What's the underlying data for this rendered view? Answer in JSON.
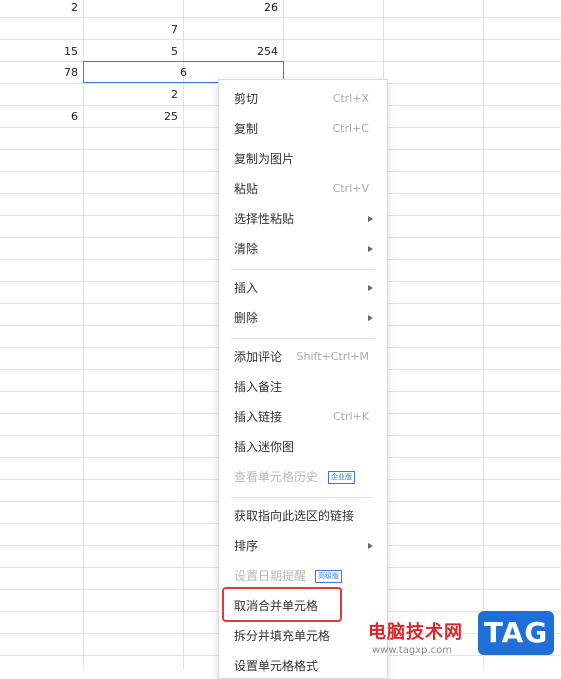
{
  "sheet": {
    "rows": [
      {
        "a": "2",
        "b": "",
        "c": "26"
      },
      {
        "a": "",
        "b": "7",
        "c": ""
      },
      {
        "a": "15",
        "b": "5",
        "c": "254"
      },
      {
        "a": "78",
        "merged": "6"
      },
      {
        "a": "",
        "b": "2",
        "c": ""
      },
      {
        "a": "6",
        "b": "25",
        "c": ""
      }
    ]
  },
  "menu": {
    "cut": {
      "label": "剪切",
      "shortcut": "Ctrl+X"
    },
    "copy": {
      "label": "复制",
      "shortcut": "Ctrl+C"
    },
    "copy_image": {
      "label": "复制为图片"
    },
    "paste": {
      "label": "粘贴",
      "shortcut": "Ctrl+V"
    },
    "paste_special": {
      "label": "选择性粘贴"
    },
    "clear": {
      "label": "清除"
    },
    "insert": {
      "label": "插入"
    },
    "delete": {
      "label": "删除"
    },
    "add_comment": {
      "label": "添加评论",
      "shortcut": "Shift+Ctrl+M"
    },
    "insert_note": {
      "label": "插入备注"
    },
    "insert_link": {
      "label": "插入链接",
      "shortcut": "Ctrl+K"
    },
    "insert_sparkline": {
      "label": "插入迷你图"
    },
    "cell_history": {
      "label": "查看单元格历史",
      "badge": "企业版"
    },
    "get_link": {
      "label": "获取指向此选区的链接"
    },
    "sort": {
      "label": "排序"
    },
    "date_reminder": {
      "label": "设置日期提醒",
      "badge": "高级版"
    },
    "unmerge": {
      "label": "取消合并单元格"
    },
    "split_fill": {
      "label": "拆分并填充单元格"
    },
    "cell_format": {
      "label": "设置单元格格式"
    }
  },
  "watermark": {
    "site_name": "电脑技术网",
    "url": "www.tagxp.com",
    "logo_text": "TAG"
  },
  "colors": {
    "selection_border": "#3a7ad9",
    "highlight_box": "#e23a3a",
    "watermark_red": "#d9272d",
    "tag_blue": "#1e6fd9"
  }
}
